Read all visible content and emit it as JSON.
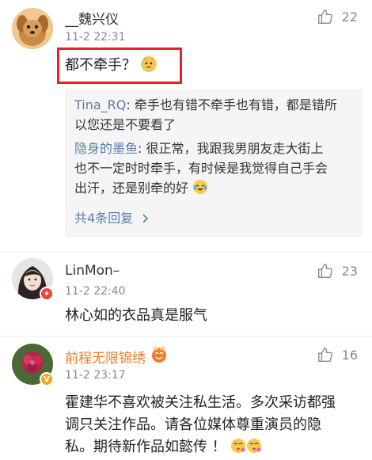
{
  "comments": [
    {
      "username": "__魏兴仪",
      "time": "11-2 22:31",
      "likes": "22",
      "text": "都不牵手？",
      "replies": [
        {
          "name": "Tina_RQ",
          "line1": "牵手也有错不牵手也有错，都是错所",
          "line2": "以您还是不要看了"
        },
        {
          "name": "隐身的墨鱼",
          "line1": "很正常，我跟我男朋友走大街上",
          "line2": "也不一定时时牵手，有时候是我觉得自己手会",
          "line3": "出汗，还是别牵的好"
        }
      ],
      "more_replies": "共4条回复"
    },
    {
      "username": "LinMon–",
      "time": "11-2 22:40",
      "likes": "23",
      "text": "林心如的衣品真是服气"
    },
    {
      "username": "前程无限锦绣",
      "time": "11-2 23:17",
      "likes": "16",
      "line1": "霍建华不喜欢被关注私生活。多次采访都强",
      "line2": "调只关注作品。请各位媒体尊重演员的隐",
      "line3": "私。期待新作品如懿传 ！"
    }
  ],
  "colors": {
    "link": "#5a7fa8",
    "vip_name": "#e87e2c",
    "highlight": "#e8202a"
  },
  "icons": {
    "like": "thumbs-up-icon",
    "chevron": "chevron-right-icon"
  }
}
